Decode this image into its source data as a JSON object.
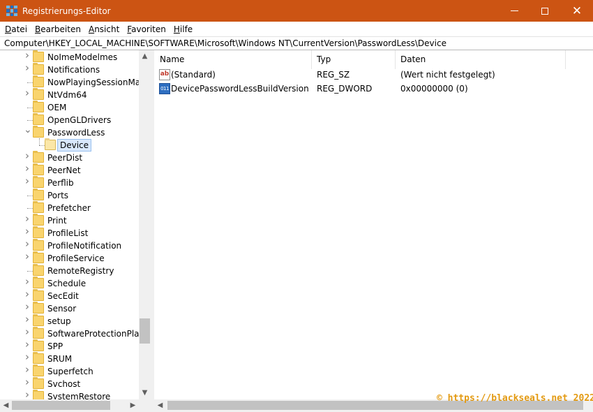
{
  "window": {
    "title": "Registrierungs-Editor",
    "minimize_glyph": "",
    "close_glyph": "✕"
  },
  "menu": [
    "Datei",
    "Bearbeiten",
    "Ansicht",
    "Favoriten",
    "Hilfe"
  ],
  "address": "Computer\\HKEY_LOCAL_MACHINE\\SOFTWARE\\Microsoft\\Windows NT\\CurrentVersion\\PasswordLess\\Device",
  "tree": {
    "items": [
      {
        "label": "NoImeModelmes",
        "expander": "collapsed"
      },
      {
        "label": "Notifications",
        "expander": "collapsed"
      },
      {
        "label": "NowPlayingSessionMana",
        "expander": "none"
      },
      {
        "label": "NtVdm64",
        "expander": "collapsed"
      },
      {
        "label": "OEM",
        "expander": "none"
      },
      {
        "label": "OpenGLDrivers",
        "expander": "none"
      },
      {
        "label": "PasswordLess",
        "expander": "expanded"
      },
      {
        "label": "Device",
        "expander": "child-selected"
      },
      {
        "label": "PeerDist",
        "expander": "collapsed"
      },
      {
        "label": "PeerNet",
        "expander": "collapsed"
      },
      {
        "label": "Perflib",
        "expander": "collapsed"
      },
      {
        "label": "Ports",
        "expander": "none"
      },
      {
        "label": "Prefetcher",
        "expander": "none"
      },
      {
        "label": "Print",
        "expander": "collapsed"
      },
      {
        "label": "ProfileList",
        "expander": "collapsed"
      },
      {
        "label": "ProfileNotification",
        "expander": "collapsed"
      },
      {
        "label": "ProfileService",
        "expander": "collapsed"
      },
      {
        "label": "RemoteRegistry",
        "expander": "none"
      },
      {
        "label": "Schedule",
        "expander": "collapsed"
      },
      {
        "label": "SecEdit",
        "expander": "collapsed"
      },
      {
        "label": "Sensor",
        "expander": "collapsed"
      },
      {
        "label": "setup",
        "expander": "collapsed"
      },
      {
        "label": "SoftwareProtectionPlatfo",
        "expander": "collapsed"
      },
      {
        "label": "SPP",
        "expander": "collapsed"
      },
      {
        "label": "SRUM",
        "expander": "collapsed"
      },
      {
        "label": "Superfetch",
        "expander": "collapsed"
      },
      {
        "label": "Svchost",
        "expander": "collapsed"
      },
      {
        "label": "SystemRestore",
        "expander": "collapsed"
      }
    ]
  },
  "list": {
    "headers": {
      "name": "Name",
      "type": "Typ",
      "data": "Daten"
    },
    "rows": [
      {
        "name": "(Standard)",
        "type": "REG_SZ",
        "data": "(Wert nicht festgelegt)",
        "icon": "ab"
      },
      {
        "name": "DevicePasswordLessBuildVersion",
        "type": "REG_DWORD",
        "data": "0x00000000 (0)",
        "icon": "011"
      }
    ]
  },
  "watermark": "© https://blackseals.net 2022"
}
